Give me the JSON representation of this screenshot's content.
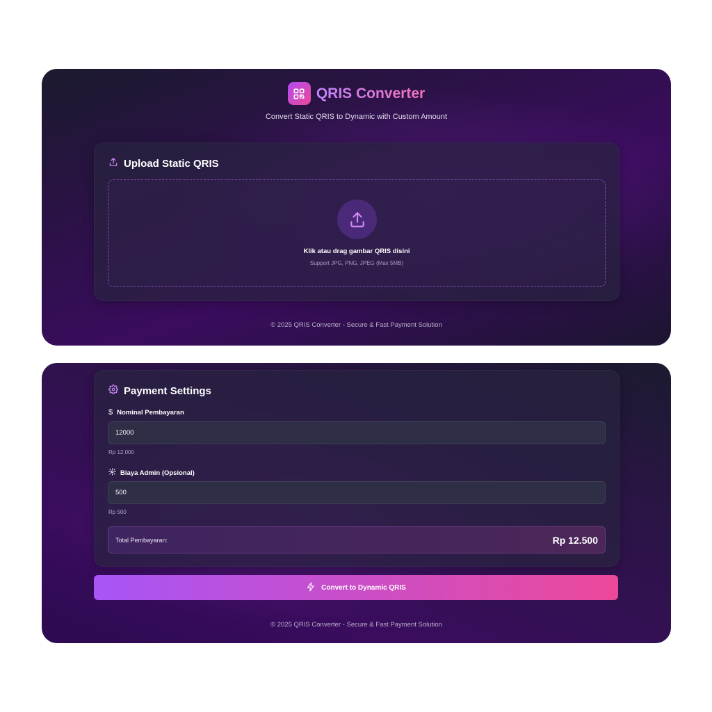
{
  "header": {
    "title": "QRIS Converter",
    "subtitle": "Convert Static QRIS to Dynamic with Custom Amount",
    "logo_icon": "qr-code-icon"
  },
  "upload": {
    "heading": "Upload Static QRIS",
    "heading_icon": "upload-icon",
    "drop_title": "Klik atau drag gambar QRIS disini",
    "drop_subtitle": "Support JPG, PNG, JPEG (Max 5MB)"
  },
  "payment": {
    "heading": "Payment Settings",
    "heading_icon": "gear-icon",
    "nominal": {
      "label": "Nominal Pembayaran",
      "icon": "dollar-icon",
      "value": "12000",
      "formatted": "Rp 12.000"
    },
    "admin": {
      "label": "Biaya Admin (Opsional)",
      "icon": "gear-icon",
      "value": "500",
      "formatted": "Rp 500"
    },
    "total_label": "Total Pembayaran:",
    "total_value": "Rp 12.500"
  },
  "convert_button": {
    "label": "Convert to Dynamic QRIS",
    "icon": "lightning-icon"
  },
  "footer": "© 2025 QRIS Converter - Secure & Fast Payment Solution",
  "colors": {
    "accent_start": "#a855f7",
    "accent_end": "#ec4899",
    "panel_dark": "#1b1a2e",
    "panel_purple": "#3a0c5e"
  }
}
